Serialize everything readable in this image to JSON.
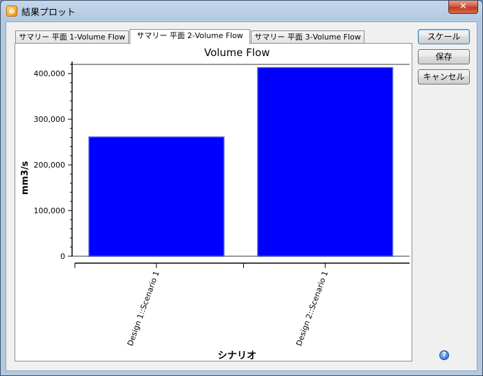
{
  "window": {
    "title": "結果プロット",
    "close_label": "✕"
  },
  "tabs": [
    {
      "label": "サマリー 平面 1-Volume Flow",
      "active": false
    },
    {
      "label": "サマリー 平面 2-Volume Flow",
      "active": true
    },
    {
      "label": "サマリー 平面 3-Volume Flow",
      "active": false
    }
  ],
  "buttons": {
    "scale": "スケール",
    "save": "保存",
    "cancel": "キャンセル"
  },
  "help": "?",
  "colors": {
    "bar": "#0000ff",
    "bar_edge": "#4a5fd9"
  },
  "chart_data": {
    "type": "bar",
    "title": "Volume Flow",
    "xlabel": "シナリオ",
    "ylabel": "mm3/s",
    "categories": [
      "Design 1::Scenario 1",
      "Design 2::Scenario 1"
    ],
    "values": [
      261000,
      413000
    ],
    "ylim": [
      0,
      420000
    ],
    "yticks": [
      0,
      100000,
      200000,
      300000,
      400000
    ],
    "ytick_labels": [
      "0",
      "100,000",
      "200,000",
      "300,000",
      "400,000"
    ],
    "grid": false,
    "legend": "none"
  }
}
